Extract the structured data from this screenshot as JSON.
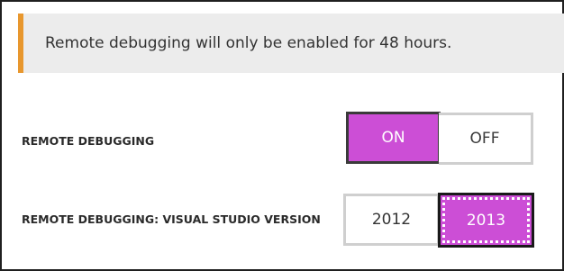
{
  "notice": {
    "text": "Remote debugging will only be enabled for 48 hours."
  },
  "remote_debugging": {
    "label": "REMOTE DEBUGGING",
    "on_label": "ON",
    "off_label": "OFF",
    "selected": "ON"
  },
  "vs_version": {
    "label": "REMOTE DEBUGGING: VISUAL STUDIO VERSION",
    "option_2012": "2012",
    "option_2013": "2013",
    "selected": "2013"
  },
  "colors": {
    "accent": "#cc4ed6",
    "notice_bar": "#e8972e",
    "notice_bg": "#ececec"
  }
}
